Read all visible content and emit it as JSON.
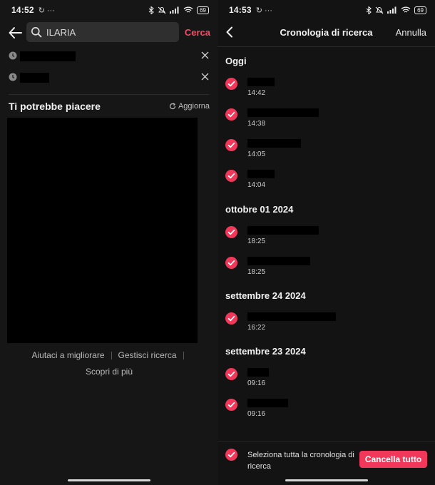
{
  "left": {
    "status": {
      "time": "14:52",
      "extra": "↻ ···",
      "battery": "69"
    },
    "search": {
      "value": "ILARIA",
      "action": "Cerca"
    },
    "history": [
      {
        "text": ""
      },
      {
        "text": ""
      }
    ],
    "suggestions": {
      "title": "Ti potrebbe piacere",
      "refresh": "Aggiorna"
    },
    "footer": {
      "help": "Aiutaci a migliorare",
      "manage": "Gestisci ricerca",
      "more": "Scopri di più"
    }
  },
  "right": {
    "status": {
      "time": "14:53",
      "extra": "↻ ···",
      "battery": "69"
    },
    "header": {
      "title": "Cronologia di ricerca",
      "cancel": "Annulla"
    },
    "groups": [
      {
        "label": "Oggi",
        "items": [
          {
            "time": "14:42"
          },
          {
            "time": "14:38"
          },
          {
            "time": "14:05"
          },
          {
            "time": "14:04"
          }
        ]
      },
      {
        "label": "ottobre 01 2024",
        "items": [
          {
            "time": "18:25"
          },
          {
            "time": "18:25"
          }
        ]
      },
      {
        "label": "settembre 24 2024",
        "items": [
          {
            "time": "16:22"
          }
        ]
      },
      {
        "label": "settembre 23 2024",
        "items": [
          {
            "time": "09:16"
          },
          {
            "time": "09:16"
          }
        ]
      }
    ],
    "bottom": {
      "select_all": "Seleziona tutta la cronologia di ricerca",
      "clear_all": "Cancella tutto"
    }
  },
  "colors": {
    "accent": "#f04e68",
    "check": "#f2385a",
    "background": "#161616"
  },
  "icons": [
    "back-arrow-icon",
    "search-icon",
    "clock-icon",
    "close-icon",
    "refresh-icon",
    "check-icon",
    "chevron-left-icon",
    "bluetooth-icon",
    "wifi-icon",
    "signal-icon",
    "battery-icon"
  ]
}
